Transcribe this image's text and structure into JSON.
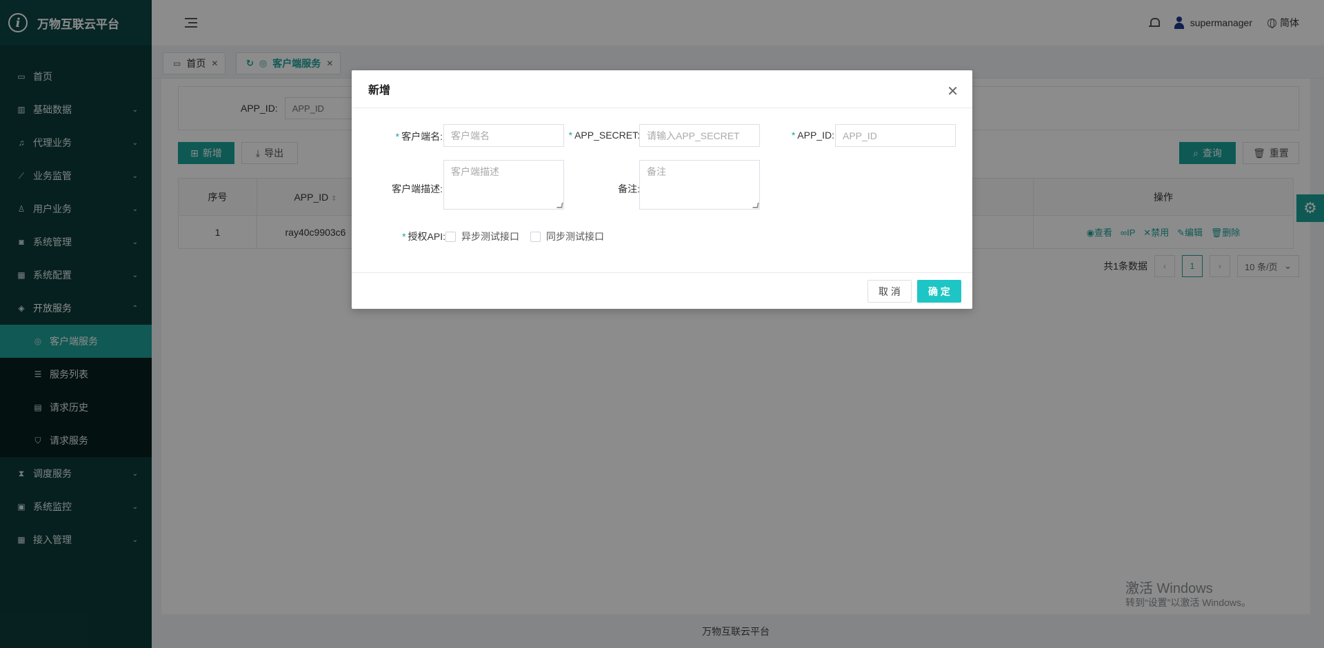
{
  "brand": {
    "title": "万物互联云平台"
  },
  "sidebar": {
    "items": [
      {
        "label": "首页",
        "icon": "calendar-icon"
      },
      {
        "label": "基础数据",
        "icon": "barcode-icon"
      },
      {
        "label": "代理业务",
        "icon": "bell-icon"
      },
      {
        "label": "业务监管",
        "icon": "chart-icon"
      },
      {
        "label": "用户业务",
        "icon": "user-icon"
      },
      {
        "label": "系统管理",
        "icon": "camera-icon"
      },
      {
        "label": "系统配置",
        "icon": "grid-icon"
      },
      {
        "label": "开放服务",
        "icon": "tag-icon"
      }
    ],
    "subitems": [
      {
        "label": "客户端服务",
        "icon": "settings-circle-icon"
      },
      {
        "label": "服务列表",
        "icon": "list-icon"
      },
      {
        "label": "请求历史",
        "icon": "calculator-icon"
      },
      {
        "label": "请求服务",
        "icon": "shield-icon"
      }
    ],
    "items_after": [
      {
        "label": "调度服务",
        "icon": "hourglass-icon"
      },
      {
        "label": "系统监控",
        "icon": "monitor-icon"
      },
      {
        "label": "接入管理",
        "icon": "grid-icon"
      }
    ]
  },
  "header": {
    "username": "supermanager",
    "language": "简体"
  },
  "tabs": [
    {
      "label": "首页"
    },
    {
      "label": "客户端服务"
    }
  ],
  "search": {
    "label": "APP_ID:",
    "placeholder": "APP_ID"
  },
  "toolbar": {
    "add": "新增",
    "export": "导出",
    "query": "查询",
    "reset": "重置"
  },
  "table": {
    "columns": {
      "index": "序号",
      "app_id": "APP_ID",
      "ops": "操作"
    },
    "rows": [
      {
        "index": "1",
        "app_id": "ray40c9903c6"
      }
    ],
    "ops": {
      "view": "查看",
      "ip": "IP",
      "disable": "禁用",
      "edit": "编辑",
      "delete": "删除"
    }
  },
  "pagination": {
    "total": "共1条数据",
    "current": "1",
    "page_size": "10 条/页"
  },
  "footer": {
    "text": "万物互联云平台"
  },
  "watermark": {
    "line1": "激活 Windows",
    "line2": "转到“设置”以激活 Windows。"
  },
  "modal": {
    "title": "新增",
    "fields": {
      "client_name": {
        "label": "客户端名:",
        "placeholder": "客户端名"
      },
      "app_secret": {
        "label": "APP_SECRET:",
        "placeholder": "请输入APP_SECRET"
      },
      "app_id": {
        "label": "APP_ID:",
        "placeholder": "APP_ID"
      },
      "client_desc": {
        "label": "客户端描述:",
        "placeholder": "客户端描述"
      },
      "remark": {
        "label": "备注:",
        "placeholder": "备注"
      },
      "auth_api": {
        "label": "授权API:",
        "options": [
          "异步测试接口",
          "同步测试接口"
        ]
      }
    },
    "cancel": "取 消",
    "confirm": "确 定"
  },
  "colors": {
    "sidebar_bg": "#0c3b3b",
    "accent": "#1aa39a",
    "confirm": "#1ec5c5"
  }
}
